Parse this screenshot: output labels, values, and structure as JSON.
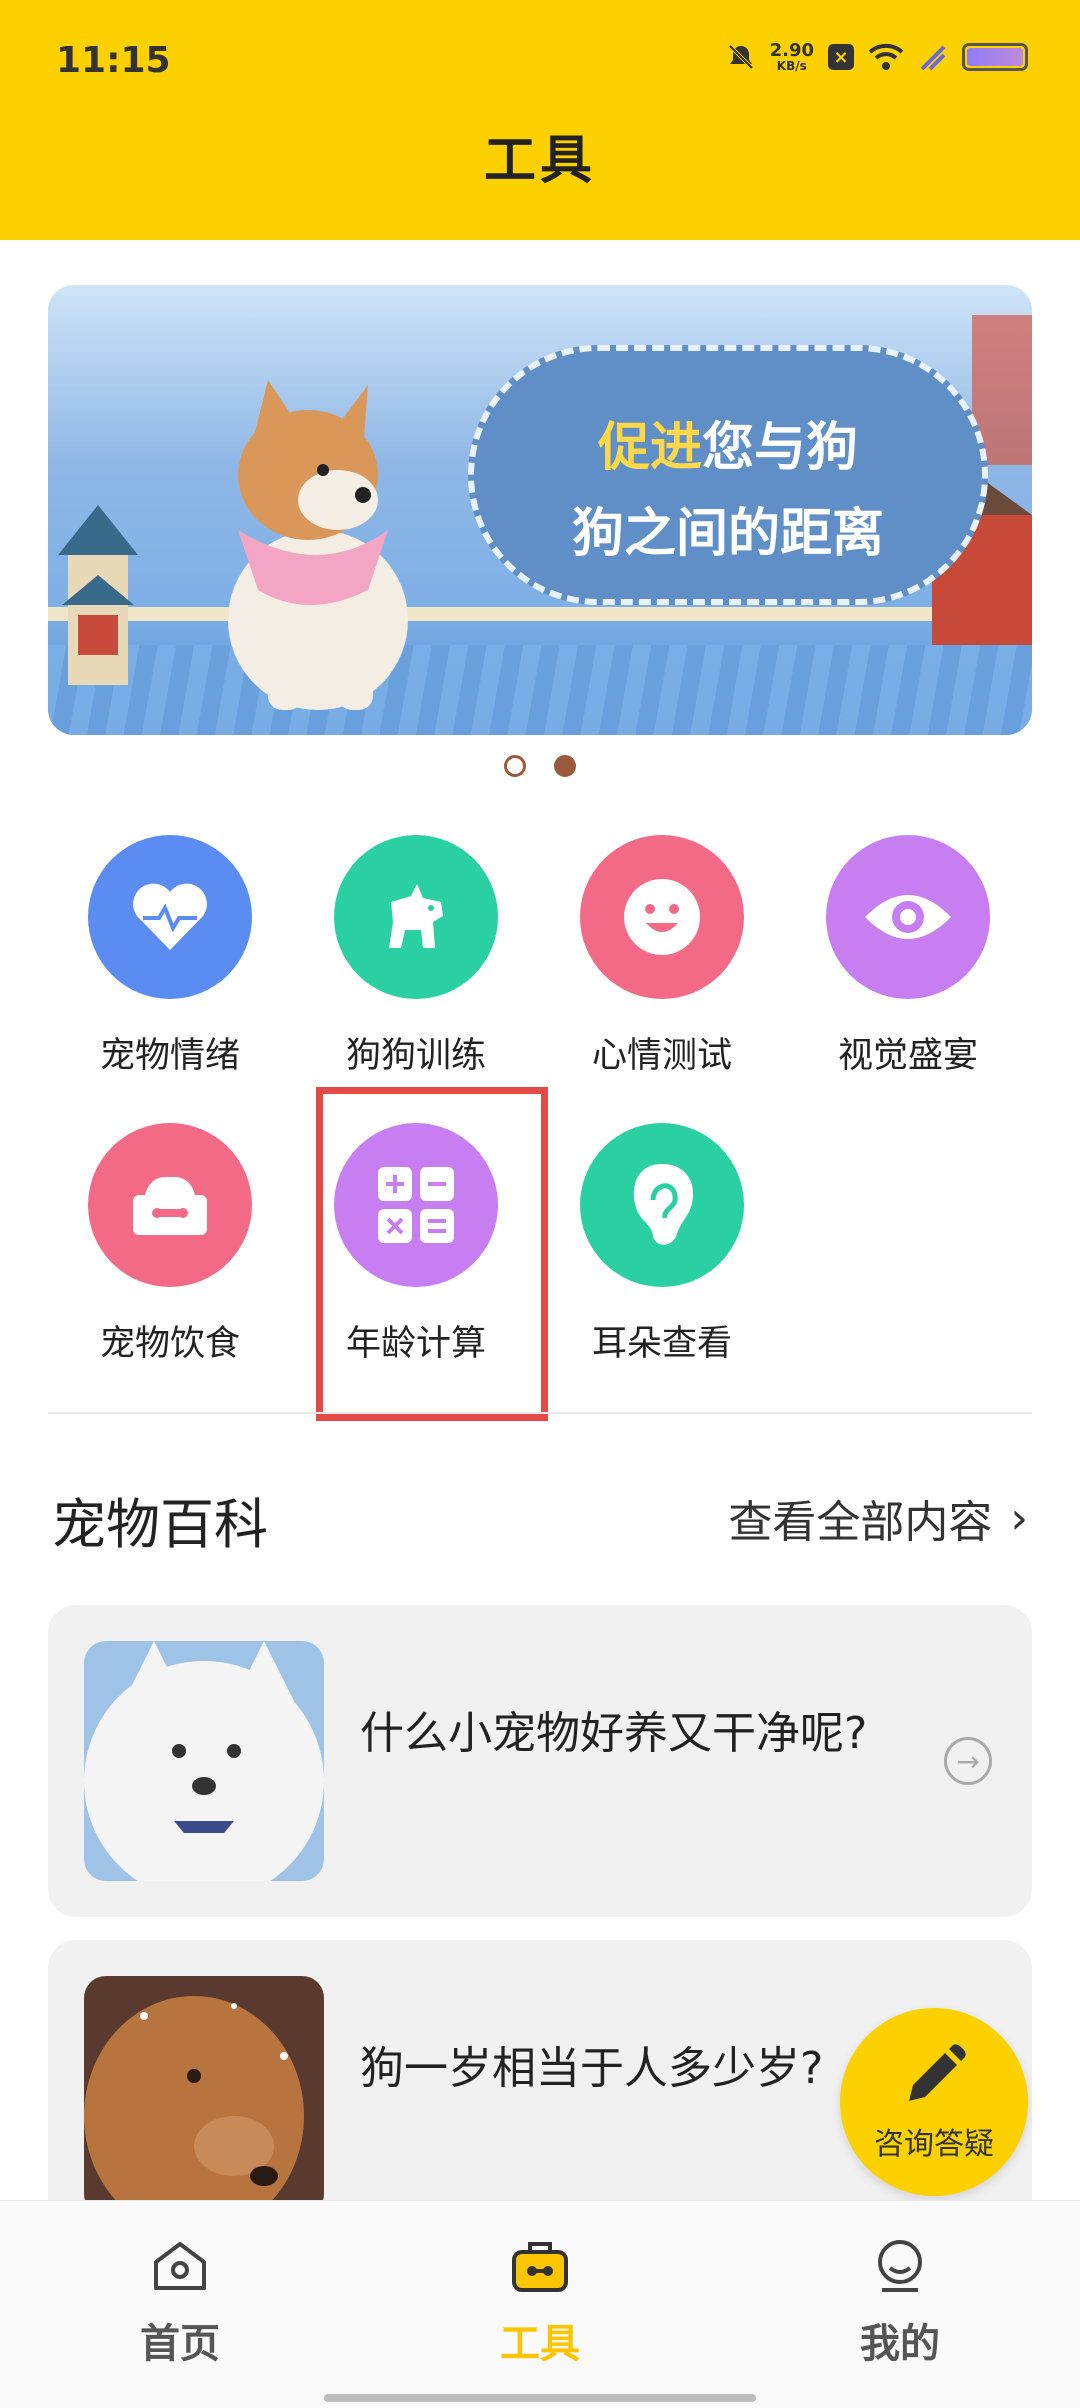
{
  "status_bar": {
    "time": "11:15",
    "net_speed_value": "2.90",
    "net_speed_unit": "KB/s"
  },
  "header": {
    "title": "工具"
  },
  "banner": {
    "text_highlight": "促进",
    "text_line1_rest": "您与狗",
    "text_line2": "狗之间的距离",
    "page_count": 2,
    "active_index": 1
  },
  "tools": [
    {
      "label": "宠物情绪",
      "icon": "heart-pulse-icon",
      "color": "#5b8cf2"
    },
    {
      "label": "狗狗训练",
      "icon": "dog-icon",
      "color": "#2ad0a2"
    },
    {
      "label": "心情测试",
      "icon": "smiley-icon",
      "color": "#f36a86"
    },
    {
      "label": "视觉盛宴",
      "icon": "eye-icon",
      "color": "#c67ef1"
    },
    {
      "label": "宠物饮食",
      "icon": "pet-bowl-icon",
      "color": "#f36a86"
    },
    {
      "label": "年龄计算",
      "icon": "calculator-icon",
      "color": "#c67ef1"
    },
    {
      "label": "耳朵查看",
      "icon": "ear-icon",
      "color": "#2ad0a2"
    }
  ],
  "section": {
    "title": "宠物百科",
    "more_label": "查看全部内容"
  },
  "articles": [
    {
      "title": "什么小宠物好养又干净呢?"
    },
    {
      "title": "狗一岁相当于人多少岁?"
    }
  ],
  "fab": {
    "label": "咨询答疑"
  },
  "bottom_nav": [
    {
      "label": "首页",
      "icon": "home-icon",
      "active": false
    },
    {
      "label": "工具",
      "icon": "toolbox-icon",
      "active": true
    },
    {
      "label": "我的",
      "icon": "profile-icon",
      "active": false
    }
  ],
  "colors": {
    "brand_yellow": "#fdd000",
    "active_nav": "#fdc400",
    "highlight_border": "#e44a48"
  }
}
